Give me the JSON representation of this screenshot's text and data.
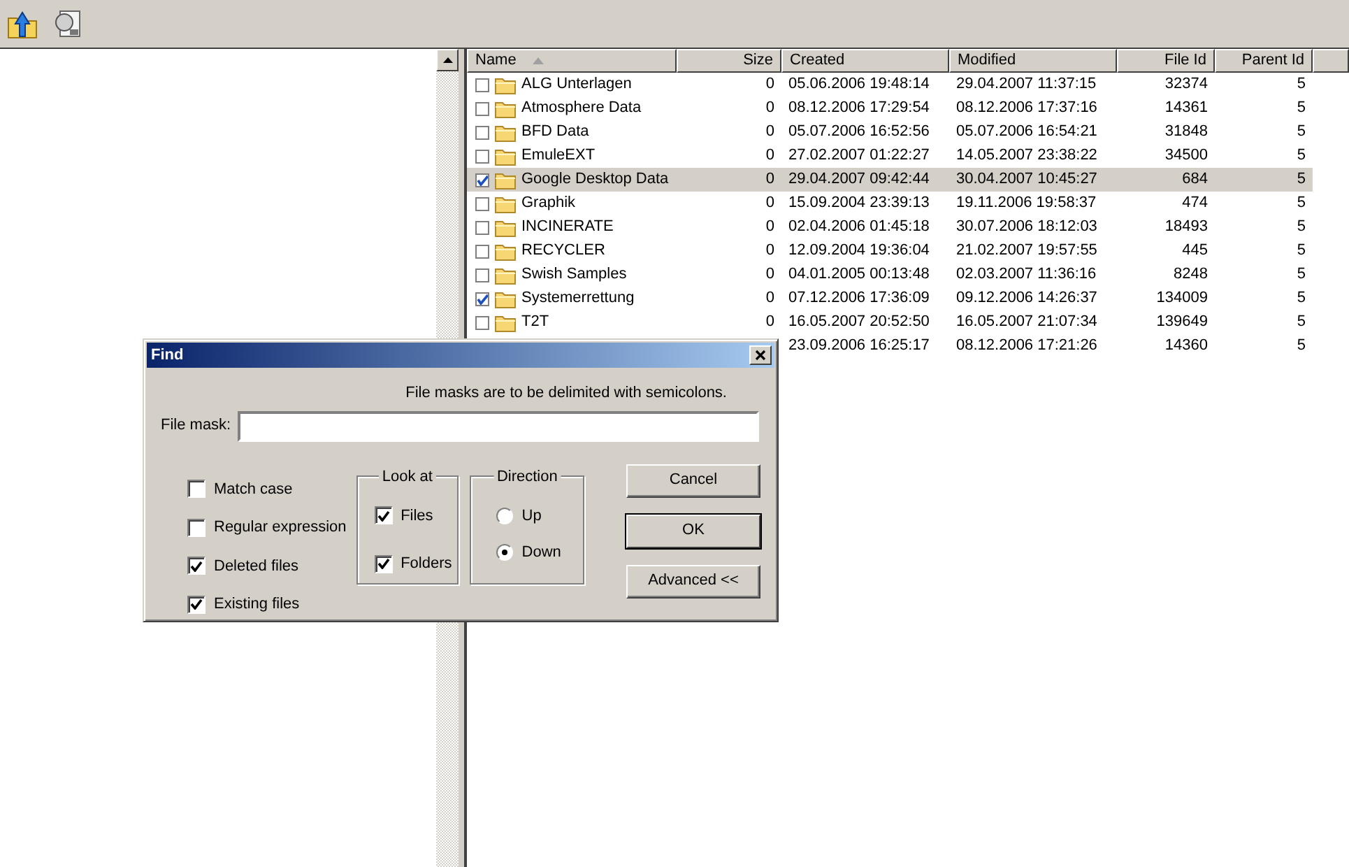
{
  "toolbar": {
    "buttons": [
      {
        "kind": "up-folder"
      },
      {
        "kind": "find"
      }
    ]
  },
  "file_list": {
    "columns": [
      {
        "label": "Name",
        "sorted": true
      },
      {
        "label": "Size",
        "sorted": false
      },
      {
        "label": "Created",
        "sorted": false
      },
      {
        "label": "Modified",
        "sorted": false
      },
      {
        "label": "File Id",
        "sorted": false
      },
      {
        "label": "Parent Id",
        "sorted": false
      }
    ],
    "rows": [
      {
        "checked": false,
        "selected": false,
        "name": "ALG Unterlagen",
        "size": "0",
        "created": "05.06.2006 19:48:14",
        "modified": "29.04.2007 11:37:15",
        "file_id": "32374",
        "parent_id": "5"
      },
      {
        "checked": false,
        "selected": false,
        "name": "Atmosphere Data",
        "size": "0",
        "created": "08.12.2006 17:29:54",
        "modified": "08.12.2006 17:37:16",
        "file_id": "14361",
        "parent_id": "5"
      },
      {
        "checked": false,
        "selected": false,
        "name": "BFD Data",
        "size": "0",
        "created": "05.07.2006 16:52:56",
        "modified": "05.07.2006 16:54:21",
        "file_id": "31848",
        "parent_id": "5"
      },
      {
        "checked": false,
        "selected": false,
        "name": "EmuleEXT",
        "size": "0",
        "created": "27.02.2007 01:22:27",
        "modified": "14.05.2007 23:38:22",
        "file_id": "34500",
        "parent_id": "5"
      },
      {
        "checked": true,
        "selected": true,
        "name": "Google Desktop Data",
        "size": "0",
        "created": "29.04.2007 09:42:44",
        "modified": "30.04.2007 10:45:27",
        "file_id": "684",
        "parent_id": "5"
      },
      {
        "checked": false,
        "selected": false,
        "name": "Graphik",
        "size": "0",
        "created": "15.09.2004 23:39:13",
        "modified": "19.11.2006 19:58:37",
        "file_id": "474",
        "parent_id": "5"
      },
      {
        "checked": false,
        "selected": false,
        "name": "INCINERATE",
        "size": "0",
        "created": "02.04.2006 01:45:18",
        "modified": "30.07.2006 18:12:03",
        "file_id": "18493",
        "parent_id": "5"
      },
      {
        "checked": false,
        "selected": false,
        "name": "RECYCLER",
        "size": "0",
        "created": "12.09.2004 19:36:04",
        "modified": "21.02.2007 19:57:55",
        "file_id": "445",
        "parent_id": "5"
      },
      {
        "checked": false,
        "selected": false,
        "name": "Swish Samples",
        "size": "0",
        "created": "04.01.2005 00:13:48",
        "modified": "02.03.2007 11:36:16",
        "file_id": "8248",
        "parent_id": "5"
      },
      {
        "checked": true,
        "selected": false,
        "name": "Systemerrettung",
        "size": "0",
        "created": "07.12.2006 17:36:09",
        "modified": "09.12.2006 14:26:37",
        "file_id": "134009",
        "parent_id": "5"
      },
      {
        "checked": false,
        "selected": false,
        "name": "T2T",
        "size": "0",
        "created": "16.05.2007 20:52:50",
        "modified": "16.05.2007 21:07:34",
        "file_id": "139649",
        "parent_id": "5"
      },
      {
        "created": "23.09.2006 16:25:17",
        "modified": "08.12.2006 17:21:26",
        "file_id": "14360",
        "parent_id": "5"
      }
    ]
  },
  "find_dialog": {
    "title": "Find",
    "hint": "File masks are to be delimited with semicolons.",
    "file_mask_label": "File mask:",
    "options": [
      {
        "label": "Match case",
        "checked": false
      },
      {
        "label": "Regular expression",
        "checked": false
      },
      {
        "label": "Deleted files",
        "checked": true
      },
      {
        "label": "Existing files",
        "checked": true
      }
    ],
    "look_at": {
      "title": "Look at",
      "options": [
        {
          "label": "Files",
          "checked": true
        },
        {
          "label": "Folders",
          "checked": true
        }
      ]
    },
    "direction": {
      "title": "Direction",
      "options": [
        {
          "label": "Up",
          "selected": false
        },
        {
          "label": "Down",
          "selected": true
        }
      ]
    },
    "buttons": [
      {
        "label": "Cancel",
        "default": false
      },
      {
        "label": "OK",
        "default": true
      },
      {
        "label": "Advanced <<",
        "default": false
      }
    ]
  }
}
